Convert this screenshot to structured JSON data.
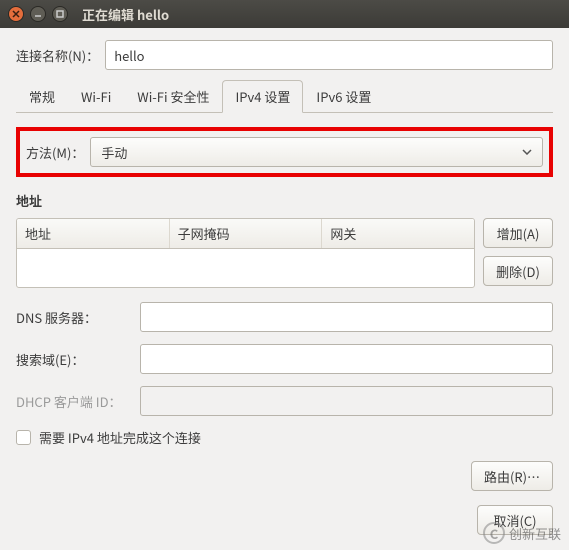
{
  "titlebar": {
    "title": "正在编辑 hello"
  },
  "connection": {
    "label": "连接名称(N)：",
    "value": "hello"
  },
  "tabs": {
    "general": "常规",
    "wifi": "Wi-Fi",
    "wifi_sec": "Wi-Fi 安全性",
    "ipv4": "IPv4 设置",
    "ipv6": "IPv6 设置"
  },
  "method": {
    "label": "方法(M)：",
    "value": "手动"
  },
  "addresses": {
    "heading": "地址",
    "cols": {
      "addr": "地址",
      "mask": "子网掩码",
      "gw": "网关"
    },
    "add": "增加(A)",
    "del": "删除(D)"
  },
  "dns": {
    "label": "DNS 服务器：",
    "value": ""
  },
  "search": {
    "label": "搜索域(E)：",
    "value": ""
  },
  "dhcp": {
    "label": "DHCP 客户端 ID：",
    "value": ""
  },
  "require": {
    "label": "需要 IPv4 地址完成这个连接"
  },
  "routes": {
    "label": "路由(R)…"
  },
  "footer": {
    "cancel": "取消(C)"
  },
  "watermark": {
    "brand": "创新互联"
  }
}
